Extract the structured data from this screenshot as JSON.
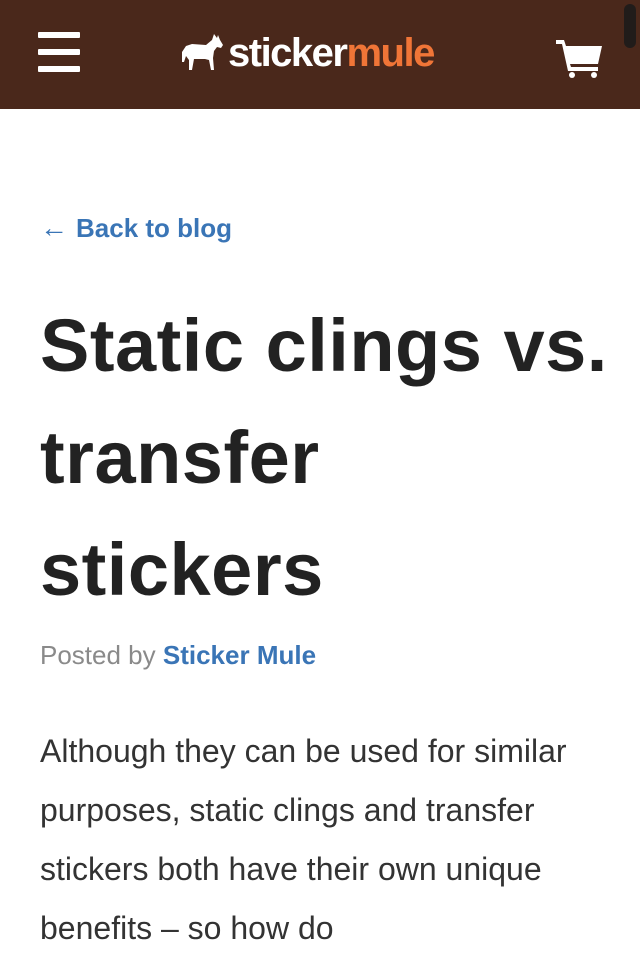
{
  "header": {
    "logo": {
      "text_primary": "sticker",
      "text_accent": "mule",
      "primary_color": "#ffffff",
      "accent_color": "#f07537"
    },
    "background_color": "#4a281b",
    "menu_icon": "hamburger-menu-icon",
    "cart_icon": "shopping-cart-icon"
  },
  "back_link": {
    "arrow": "←",
    "label": "Back to blog"
  },
  "article": {
    "title": "Static clings vs. transfer stickers",
    "byline_prefix": "Posted by",
    "author": "Sticker Mule",
    "intro": "Although they can be used for similar purposes, static clings and transfer stickers both have their own unique benefits – so how do"
  },
  "colors": {
    "link": "#3a75b6",
    "text": "#222222",
    "muted": "#8a8a8a"
  }
}
